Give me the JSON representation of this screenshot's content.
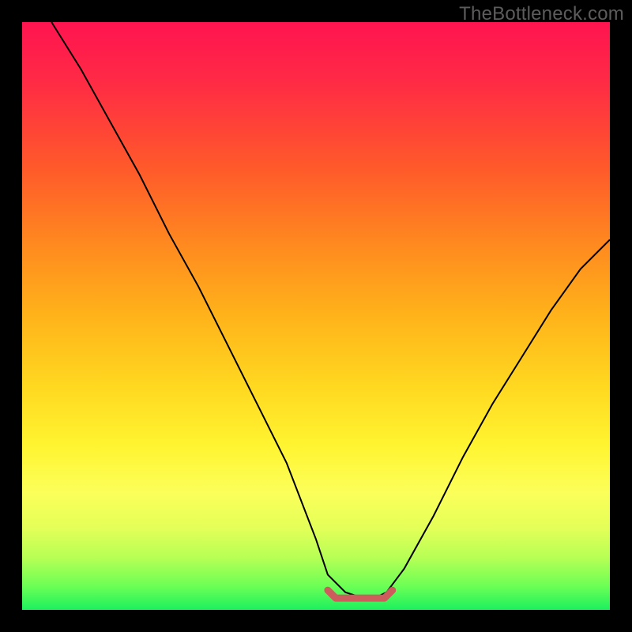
{
  "watermark": "TheBottleneck.com",
  "chart_data": {
    "type": "line",
    "title": "",
    "xlabel": "",
    "ylabel": "",
    "xlim": [
      0,
      100
    ],
    "ylim": [
      0,
      100
    ],
    "series": [
      {
        "name": "bottleneck-curve",
        "x": [
          5,
          10,
          15,
          20,
          25,
          30,
          35,
          40,
          45,
          50,
          52,
          55,
          58,
          60,
          62,
          65,
          70,
          75,
          80,
          85,
          90,
          95,
          100
        ],
        "values": [
          100,
          92,
          83,
          74,
          64,
          55,
          45,
          35,
          25,
          12,
          6,
          3,
          2,
          2,
          3,
          7,
          16,
          26,
          35,
          43,
          51,
          58,
          63
        ]
      }
    ],
    "annotations": [
      {
        "name": "optimal-flat-region",
        "x_start": 52,
        "x_end": 63,
        "y": 2
      }
    ],
    "gradient_stops": [
      {
        "pos": 0,
        "color": "#ff1450"
      },
      {
        "pos": 25,
        "color": "#ff5a2a"
      },
      {
        "pos": 50,
        "color": "#ffb31a"
      },
      {
        "pos": 72,
        "color": "#fff430"
      },
      {
        "pos": 91,
        "color": "#b8ff55"
      },
      {
        "pos": 100,
        "color": "#1cf05e"
      }
    ],
    "grid": false,
    "legend": false
  }
}
